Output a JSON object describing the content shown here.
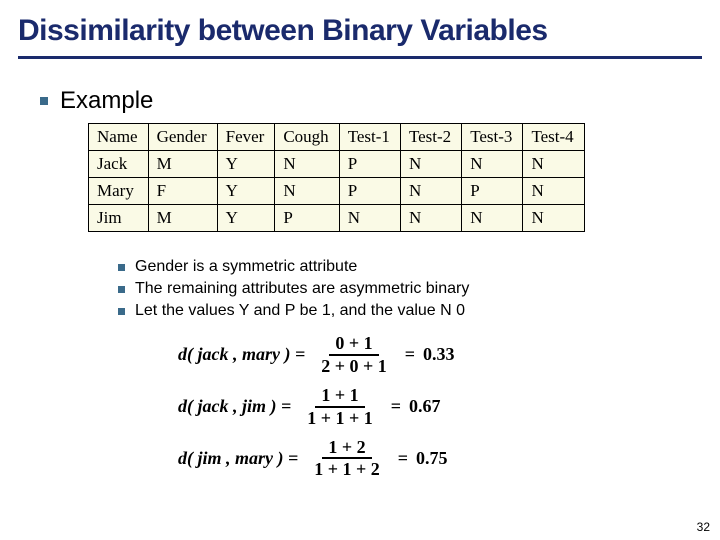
{
  "title": "Dissimilarity between Binary Variables",
  "bullet_main": "Example",
  "table": {
    "headers": [
      "Name",
      "Gender",
      "Fever",
      "Cough",
      "Test-1",
      "Test-2",
      "Test-3",
      "Test-4"
    ],
    "rows": [
      [
        "Jack",
        "M",
        "Y",
        "N",
        "P",
        "N",
        "N",
        "N"
      ],
      [
        "Mary",
        "F",
        "Y",
        "N",
        "P",
        "N",
        "P",
        "N"
      ],
      [
        "Jim",
        "M",
        "Y",
        "P",
        "N",
        "N",
        "N",
        "N"
      ]
    ]
  },
  "sub_bullets": [
    "Gender is a symmetric attribute",
    "The remaining attributes are asymmetric binary",
    "Let the values Y and P be 1, and the value N 0"
  ],
  "equations": [
    {
      "lhs": "d( jack , mary ) =",
      "num": "0 + 1",
      "den": "2 + 0 + 1",
      "rhs": "0.33"
    },
    {
      "lhs": "d( jack , jim ) =",
      "num": "1 + 1",
      "den": "1 + 1 + 1",
      "rhs": "0.67"
    },
    {
      "lhs": "d( jim , mary ) =",
      "num": "1 + 2",
      "den": "1 + 1 + 2",
      "rhs": "0.75"
    }
  ],
  "page_number": "32",
  "chart_data": {
    "type": "table",
    "columns": [
      "Name",
      "Gender",
      "Fever",
      "Cough",
      "Test-1",
      "Test-2",
      "Test-3",
      "Test-4"
    ],
    "rows": [
      {
        "Name": "Jack",
        "Gender": "M",
        "Fever": "Y",
        "Cough": "N",
        "Test-1": "P",
        "Test-2": "N",
        "Test-3": "N",
        "Test-4": "N"
      },
      {
        "Name": "Mary",
        "Gender": "F",
        "Fever": "Y",
        "Cough": "N",
        "Test-1": "P",
        "Test-2": "N",
        "Test-3": "P",
        "Test-4": "N"
      },
      {
        "Name": "Jim",
        "Gender": "M",
        "Fever": "Y",
        "Cough": "P",
        "Test-1": "N",
        "Test-2": "N",
        "Test-3": "N",
        "Test-4": "N"
      }
    ],
    "dissimilarities": [
      {
        "pair": [
          "jack",
          "mary"
        ],
        "numerator": "0+1",
        "denominator": "2+0+1",
        "value": 0.33
      },
      {
        "pair": [
          "jack",
          "jim"
        ],
        "numerator": "1+1",
        "denominator": "1+1+1",
        "value": 0.67
      },
      {
        "pair": [
          "jim",
          "mary"
        ],
        "numerator": "1+2",
        "denominator": "1+1+2",
        "value": 0.75
      }
    ]
  }
}
